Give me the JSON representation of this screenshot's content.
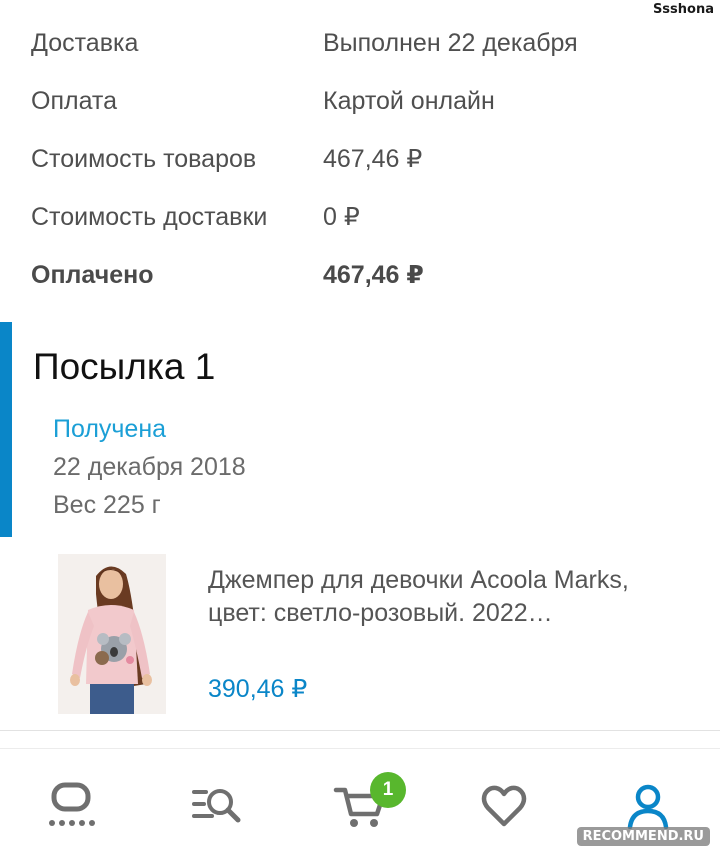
{
  "header": {
    "username": "Ssshona"
  },
  "order_info": [
    {
      "label": "Доставка",
      "value": "Выполнен 22 декабря"
    },
    {
      "label": "Оплата",
      "value": "Картой онлайн"
    },
    {
      "label": "Стоимость товаров",
      "value": "467,46 ₽"
    },
    {
      "label": "Стоимость доставки",
      "value": "0 ₽"
    },
    {
      "label": "Оплачено",
      "value": "467,46 ₽"
    }
  ],
  "parcel": {
    "title": "Посылка 1",
    "status": "Получена",
    "date": "22 декабря 2018",
    "weight": "Вес 225 г"
  },
  "product": {
    "name": "Джемпер для девочки Acoola Marks, цвет: светло-розовый. 2022…",
    "price": "390,46 ₽"
  },
  "bottom_nav": {
    "cart_badge": "1",
    "items": [
      "home-icon",
      "catalog-search-icon",
      "cart-icon",
      "favorites-icon",
      "profile-icon"
    ],
    "active_color": "#0a86c8",
    "icon_color": "#6f6f6f",
    "badge_color": "#58b72d"
  },
  "watermark": "RECOMMEND.RU"
}
